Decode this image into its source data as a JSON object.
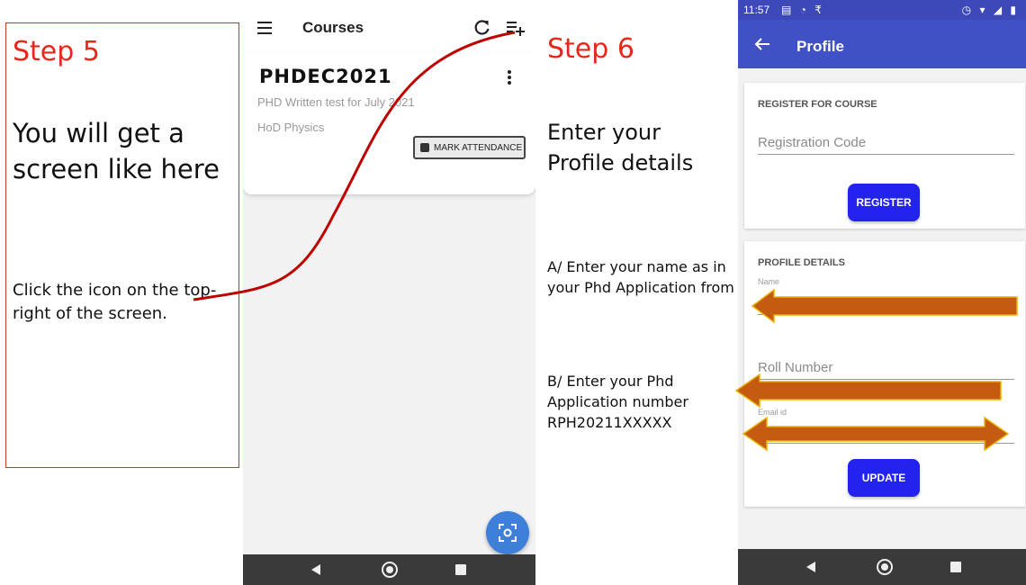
{
  "step5": {
    "title": "Step 5",
    "heading": "You will get a screen like here",
    "instruction": "Click the icon on the top-right of the screen."
  },
  "courses_screen": {
    "appbar_title": "Courses",
    "course": {
      "code": "PHDEC2021",
      "description": "PHD Written test for July 2021",
      "owner": "HoD Physics",
      "attendance_button": "MARK ATTENDANCE"
    }
  },
  "step6": {
    "title": "Step 6",
    "heading": "Enter your Profile details",
    "instruction_a": "A/ Enter your name as in your Phd Application from",
    "instruction_b": "B/ Enter your Phd Application number RPH20211XXXXX"
  },
  "profile_screen": {
    "status_time": "11:57",
    "status_left_icons": "▤ ◔ ₹",
    "status_right_icons": "◷ ▾ ◢ ▮",
    "appbar_title": "Profile",
    "register_section": {
      "title": "REGISTER FOR COURSE",
      "code_placeholder": "Registration Code",
      "register_button": "REGISTER"
    },
    "profile_section": {
      "title": "PROFILE DETAILS",
      "name_label": "Name",
      "roll_placeholder": "Roll Number",
      "email_label": "Email id",
      "update_button": "UPDATE"
    }
  },
  "colors": {
    "step_title": "#e5281b",
    "annotation_curve": "#c00000",
    "annotation_arrow": "#c55a11",
    "profile_appbar": "#3f51c5",
    "button_blue": "#2323f0",
    "fab_blue": "#3d7fd9"
  }
}
